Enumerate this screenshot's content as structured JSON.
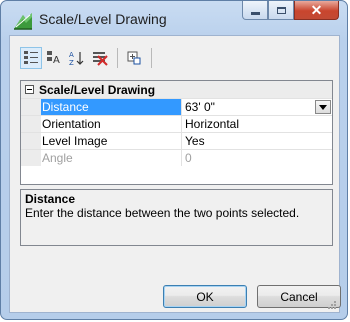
{
  "window": {
    "title": "Scale/Level Drawing",
    "app_icon": "scale-level-drawing-icon"
  },
  "caption_buttons": [
    "minimize-icon",
    "maximize-icon",
    "close-icon"
  ],
  "toolbar": {
    "buttons": [
      "categorized-icon",
      "property-pages-icon",
      "alphabetical-sort-icon",
      "clear-icon",
      "expand-icon"
    ]
  },
  "grid": {
    "category": "Scale/Level Drawing",
    "rows": [
      {
        "name": "Distance",
        "value": "63' 0\"",
        "selected": true,
        "has_dropdown": true
      },
      {
        "name": "Orientation",
        "value": "Horizontal"
      },
      {
        "name": "Level Image",
        "value": "Yes"
      },
      {
        "name": "Angle",
        "value": "0",
        "disabled": true
      }
    ]
  },
  "help": {
    "title": "Distance",
    "text": "Enter the distance between the two points selected."
  },
  "buttons": {
    "ok": "OK",
    "cancel": "Cancel"
  }
}
